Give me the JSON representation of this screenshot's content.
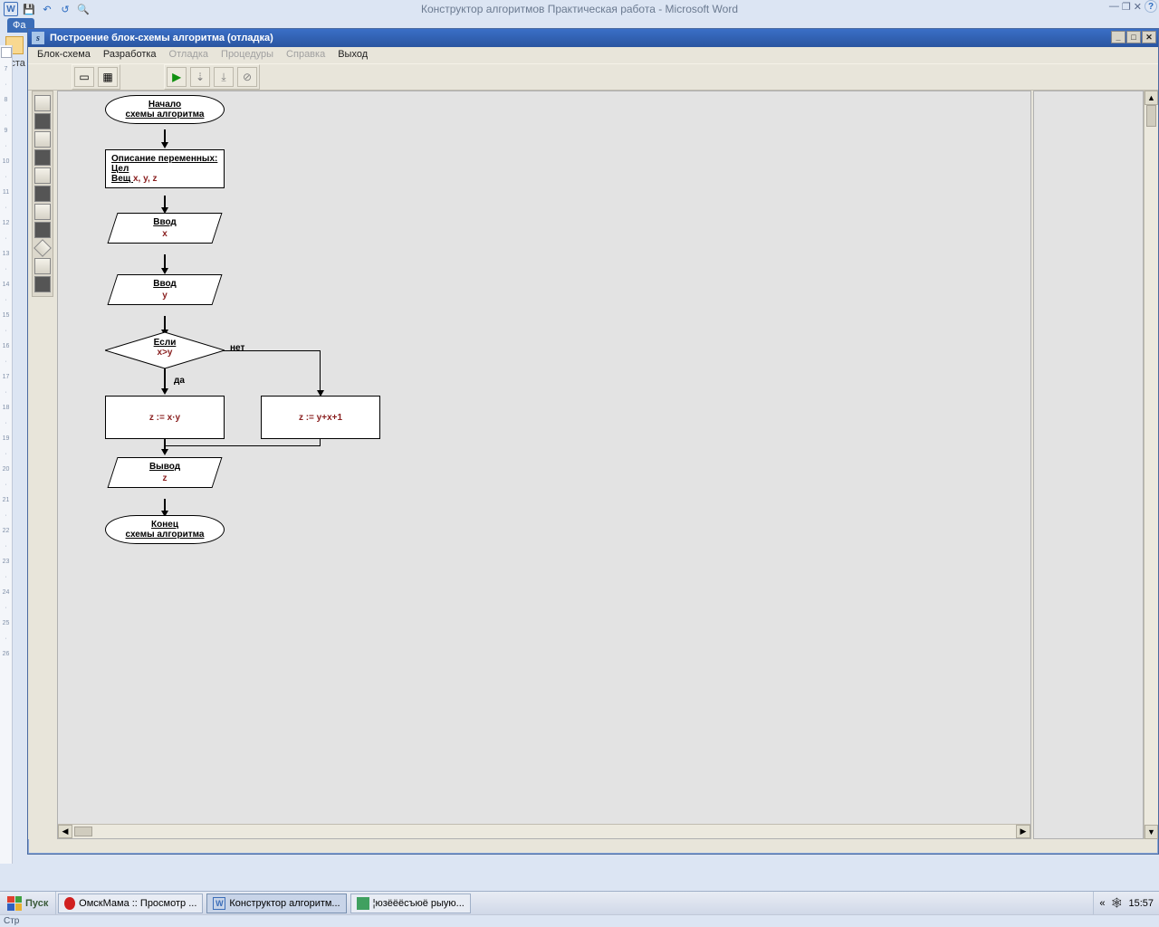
{
  "word": {
    "title": "Конструктор алгоритмов Практическая работа - Microsoft Word",
    "tab": "Фа",
    "left1": "Вста",
    "status": "Стр"
  },
  "app": {
    "title": "Построение блок-схемы алгоритма (отладка)",
    "menu": {
      "blokschema": "Блок-схема",
      "razrabotka": "Разработка",
      "otladka": "Отладка",
      "procedury": "Процедуры",
      "spravka": "Справка",
      "vyhod": "Выход"
    }
  },
  "flow": {
    "start1": "Начало",
    "start2": "схемы алгоритма",
    "desc_hdr": "Описание переменных:",
    "desc_cel": "Цел",
    "desc_vesh": "Вещ ",
    "desc_vars": "x, y, z",
    "input_lbl": "Ввод",
    "input_x": "x",
    "input_y": "y",
    "if_lbl": "Если",
    "if_cond": "x>y",
    "no_lbl": "нет",
    "yes_lbl": "да",
    "p1": "z := x·y",
    "p2": "z := y+x+1",
    "out_lbl": "Вывод",
    "out_var": "z",
    "end1": "Конец",
    "end2": "схемы алгоритма"
  },
  "ruler": {
    "nums": [
      "7",
      "8",
      "9",
      "10",
      "11",
      "12",
      "13",
      "14",
      "15",
      "16",
      "17",
      "18",
      "19",
      "20",
      "21",
      "22",
      "23",
      "24",
      "25",
      "26"
    ]
  },
  "taskbar": {
    "start": "Пуск",
    "t1": "ОмскМама :: Просмотр ...",
    "t2": "Конструктор алгоритм...",
    "t3": "¦юзёёёсъюё рыую...",
    "time": "15:57",
    "chev": "«"
  }
}
